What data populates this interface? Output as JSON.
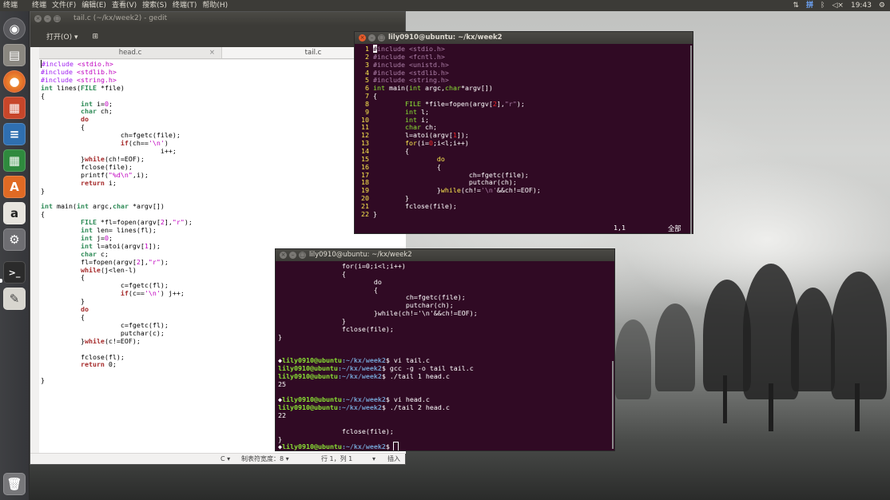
{
  "top_panel": {
    "app_name": "终端",
    "menus": [
      "终端",
      "文件(F)",
      "编辑(E)",
      "查看(V)",
      "搜索(S)",
      "终端(T)",
      "帮助(H)"
    ],
    "input_method": "拼",
    "clock": "19:43"
  },
  "launcher": {
    "items": [
      "dash-home",
      "files",
      "firefox",
      "impress",
      "writer",
      "calc",
      "software-center",
      "amazon",
      "system-settings",
      "terminal",
      "text-editor",
      "trash"
    ]
  },
  "gedit": {
    "title": "tail.c (~/kx/week2) - gedit",
    "open_label": "打开(O)",
    "tabs": [
      {
        "label": "head.c",
        "close": "×"
      },
      {
        "label": "tail.c"
      }
    ],
    "code": [
      "#include <stdio.h>",
      "#include <stdlib.h>",
      "#include <string.h>",
      "int lines(FILE *file)",
      "{",
      "\t\tint i=0;",
      "\t\tchar ch;",
      "\t\tdo",
      "\t\t{",
      "\t\t\t\tch=fgetc(file);",
      "\t\t\t\tif(ch=='\\n')",
      "\t\t\t\t\t\ti++;",
      "\t\t}while(ch!=EOF);",
      "\t\tfclose(file);",
      "\t\tprintf(\"%d\\n\",i);",
      "\t\treturn i;",
      "}",
      "",
      "int main(int argc,char *argv[])",
      "{",
      "\t\tFILE *fl=fopen(argv[2],\"r\");",
      "\t\tint len= lines(fl);",
      "\t\tint j=0;",
      "\t\tint l=atoi(argv[1]);",
      "\t\tchar c;",
      "\t\tfl=fopen(argv[2],\"r\");",
      "\t\twhile(j<len-l)",
      "\t\t{",
      "\t\t\t\tc=fgetc(fl);",
      "\t\t\t\tif(c=='\\n') j++;",
      "\t\t}",
      "\t\tdo",
      "\t\t{",
      "\t\t\t\tc=fgetc(fl);",
      "\t\t\t\tputchar(c);",
      "\t\t}while(c!=EOF);",
      "",
      "\t\tfclose(fl);",
      "\t\treturn 0;",
      "",
      "}"
    ],
    "status": {
      "language": "C ▾",
      "tab_width": "制表符宽度：8 ▾",
      "position": "行 1，列 1",
      "dropdown": "▾",
      "mode": "插入"
    }
  },
  "vim_terminal": {
    "title": "lily0910@ubuntu: ~/kx/week2",
    "lines": [
      {
        "n": "1",
        "t": "#include <stdio.h>"
      },
      {
        "n": "2",
        "t": "#include <fcntl.h>"
      },
      {
        "n": "3",
        "t": "#include <unistd.h>"
      },
      {
        "n": "4",
        "t": "#include <stdlib.h>"
      },
      {
        "n": "5",
        "t": "#include <string.h>"
      },
      {
        "n": "6",
        "t": "int main(int argc,char*argv[])"
      },
      {
        "n": "7",
        "t": "{"
      },
      {
        "n": "8",
        "t": "        FILE *file=fopen(argv[2],\"r\");"
      },
      {
        "n": "9",
        "t": "        int l;"
      },
      {
        "n": "10",
        "t": "        int i;"
      },
      {
        "n": "11",
        "t": "        char ch;"
      },
      {
        "n": "12",
        "t": "        l=atoi(argv[1]);"
      },
      {
        "n": "13",
        "t": "        for(i=0;i<l;i++)"
      },
      {
        "n": "14",
        "t": "        {"
      },
      {
        "n": "15",
        "t": "                do"
      },
      {
        "n": "16",
        "t": "                {"
      },
      {
        "n": "17",
        "t": "                        ch=fgetc(file);"
      },
      {
        "n": "18",
        "t": "                        putchar(ch);"
      },
      {
        "n": "19",
        "t": "                }while(ch!='\\n'&&ch!=EOF);"
      },
      {
        "n": "20",
        "t": "        }"
      },
      {
        "n": "21",
        "t": "        fclose(file);"
      },
      {
        "n": "22",
        "t": "}"
      }
    ],
    "tilde": "~",
    "ruler": "1,1",
    "scroll_pos": "全部"
  },
  "shell_terminal": {
    "title": "lily0910@ubuntu: ~/kx/week2",
    "prompt_user": "lily0910@ubuntu",
    "prompt_path": ":~/kx/week2",
    "lines": [
      {
        "kind": "out",
        "text": "                for(i=0;i<l;i++)"
      },
      {
        "kind": "out",
        "text": "                {"
      },
      {
        "kind": "out",
        "text": "                        do"
      },
      {
        "kind": "out",
        "text": "                        {"
      },
      {
        "kind": "out",
        "text": "                                ch=fgetc(file);"
      },
      {
        "kind": "out",
        "text": "                                putchar(ch);"
      },
      {
        "kind": "out",
        "text": "                        }while(ch!='\\n'&&ch!=EOF);"
      },
      {
        "kind": "out",
        "text": "                }"
      },
      {
        "kind": "out",
        "text": "                fclose(file);"
      },
      {
        "kind": "out",
        "text": "}"
      },
      {
        "kind": "out",
        "text": ""
      },
      {
        "kind": "out",
        "text": ""
      },
      {
        "kind": "prompt",
        "lead": "◆",
        "cmd": "$ vi tail.c"
      },
      {
        "kind": "prompt",
        "lead": "",
        "cmd": "$ gcc -g -o tail tail.c"
      },
      {
        "kind": "prompt",
        "lead": "",
        "cmd": "$ ./tail 1 head.c"
      },
      {
        "kind": "out",
        "text": "25"
      },
      {
        "kind": "out",
        "text": ""
      },
      {
        "kind": "prompt",
        "lead": "◆",
        "cmd": "$ vi head.c"
      },
      {
        "kind": "prompt",
        "lead": "",
        "cmd": "$ ./tail 2 head.c"
      },
      {
        "kind": "out",
        "text": "22"
      },
      {
        "kind": "out",
        "text": ""
      },
      {
        "kind": "out",
        "text": "                fclose(file);"
      },
      {
        "kind": "out",
        "text": "}"
      },
      {
        "kind": "prompt",
        "lead": "◆",
        "cmd": "$ ",
        "cursor": true
      }
    ]
  },
  "colors": {
    "terminal_bg": "#300a24",
    "panel_bg": "#3c3b37",
    "prompt_user": "#8ae234",
    "prompt_path": "#729fcf",
    "close_button": "#e85c2c"
  }
}
